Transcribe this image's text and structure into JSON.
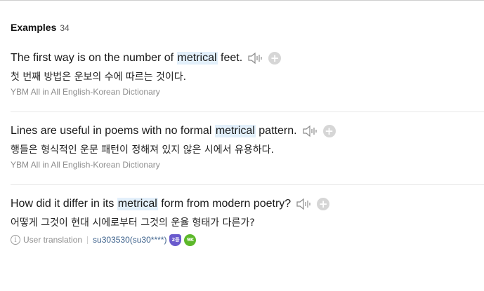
{
  "section": {
    "title": "Examples",
    "count": "34"
  },
  "examples": [
    {
      "en_before": "The first way is on the number of ",
      "en_highlight": "metrical",
      "en_after": " feet.",
      "ko": "첫 번째 방법은 운보의 수에 따르는 것이다.",
      "source": "YBM All in All English-Korean Dictionary"
    },
    {
      "en_before": "Lines are useful in poems with no formal ",
      "en_highlight": "metrical",
      "en_after": " pattern.",
      "ko": "행들은 형식적인 운문 패턴이 정해져 있지 않은 시에서 유용하다.",
      "source": "YBM All in All English-Korean Dictionary"
    },
    {
      "en_before": "How did it differ in its ",
      "en_highlight": "metrical",
      "en_after": " form from modern poetry?",
      "ko": "어떻게 그것이 현대 시에로부터 그것의 운율 형태가 다른가?",
      "user_label": "User translation",
      "user_name": "su303530(su30****)",
      "badges": [
        {
          "icon": "rank-shield-badge-icon",
          "text": "2등",
          "color": "#6a5acd"
        },
        {
          "icon": "level-badge-icon",
          "text": "9K",
          "color": "#5cb82a"
        }
      ]
    }
  ],
  "icons": {
    "speaker": "speaker-icon",
    "plus": "plus-icon",
    "info": "info-icon"
  },
  "colors": {
    "highlight": "#e3f0fb",
    "source_text": "#8e8e8e",
    "user_link": "#3a5f8a"
  }
}
